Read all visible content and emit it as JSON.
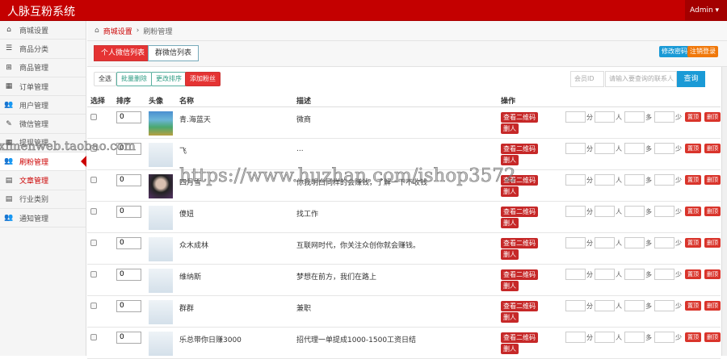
{
  "app": {
    "title": "人脉互粉系统",
    "user": "Admin"
  },
  "sidebar": [
    {
      "label": "商城设置",
      "icon": "home-icon",
      "glyph": "⌂"
    },
    {
      "label": "商品分类",
      "icon": "list-icon",
      "glyph": "☰"
    },
    {
      "label": "商品管理",
      "icon": "gift-icon",
      "glyph": "⊞"
    },
    {
      "label": "订单管理",
      "icon": "calendar-icon",
      "glyph": "▦"
    },
    {
      "label": "用户管理",
      "icon": "users-icon",
      "glyph": "👥"
    },
    {
      "label": "微信管理",
      "icon": "edit-icon",
      "glyph": "✎"
    },
    {
      "label": "提现管理",
      "icon": "calendar-icon",
      "glyph": "▦"
    },
    {
      "label": "刷粉管理",
      "icon": "users-icon",
      "glyph": "👥",
      "active": true
    },
    {
      "label": "文章管理",
      "icon": "article-icon",
      "glyph": "▤",
      "red": true
    },
    {
      "label": "行业类别",
      "icon": "article-icon",
      "glyph": "▤"
    },
    {
      "label": "通知管理",
      "icon": "users-icon",
      "glyph": "👥"
    }
  ],
  "breadcrumb": {
    "home": "商城设置",
    "current": "刷粉管理"
  },
  "tabs": {
    "personal": "个人微信列表",
    "group": "群微信列表"
  },
  "top_buttons": {
    "change_password": "修改密码",
    "logout": "注销登录"
  },
  "toolbar": {
    "select_all": "全选",
    "batch_delete": "批量删除",
    "change_sort": "更改排序",
    "add_fans": "添加粉丝",
    "member_id_placeholder": "会员ID",
    "contact_placeholder": "请输入要查询的联系人",
    "search": "查询"
  },
  "columns": {
    "select": "选择",
    "sort": "排序",
    "avatar": "头像",
    "name": "名称",
    "desc": "描述",
    "ops": "操作"
  },
  "row_labels": {
    "qr": "查看二维码",
    "delete_person": "删人",
    "fen": "分",
    "ren": "人",
    "duo": "多",
    "shao": "少",
    "pin": "置顶",
    "unpin": "删顶"
  },
  "rows": [
    {
      "sort": "0",
      "name": "青.海蓝天",
      "desc": "微商",
      "avatar": "p1"
    },
    {
      "sort": "0",
      "name": "飞",
      "desc": "...",
      "avatar": ""
    },
    {
      "sort": "0",
      "name": "四月雪",
      "desc": "你我明白同样的会赚钱，了解一下不收钱",
      "avatar": "p2"
    },
    {
      "sort": "0",
      "name": "傻妞",
      "desc": "找工作",
      "avatar": ""
    },
    {
      "sort": "0",
      "name": "众木成林",
      "desc": "互联网时代，你关注众创你就会赚钱。",
      "avatar": ""
    },
    {
      "sort": "0",
      "name": "维纳斯",
      "desc": "梦想在前方，我们在路上",
      "avatar": ""
    },
    {
      "sort": "0",
      "name": "群群",
      "desc": "兼职",
      "avatar": ""
    },
    {
      "sort": "0",
      "name": "乐总带你日赚3000",
      "desc": "招代理一单提成1000-1500工资日结",
      "avatar": ""
    }
  ],
  "watermarks": [
    "ximenweb.taobao.com",
    "https://www.huzhan.com/ishop3572"
  ]
}
